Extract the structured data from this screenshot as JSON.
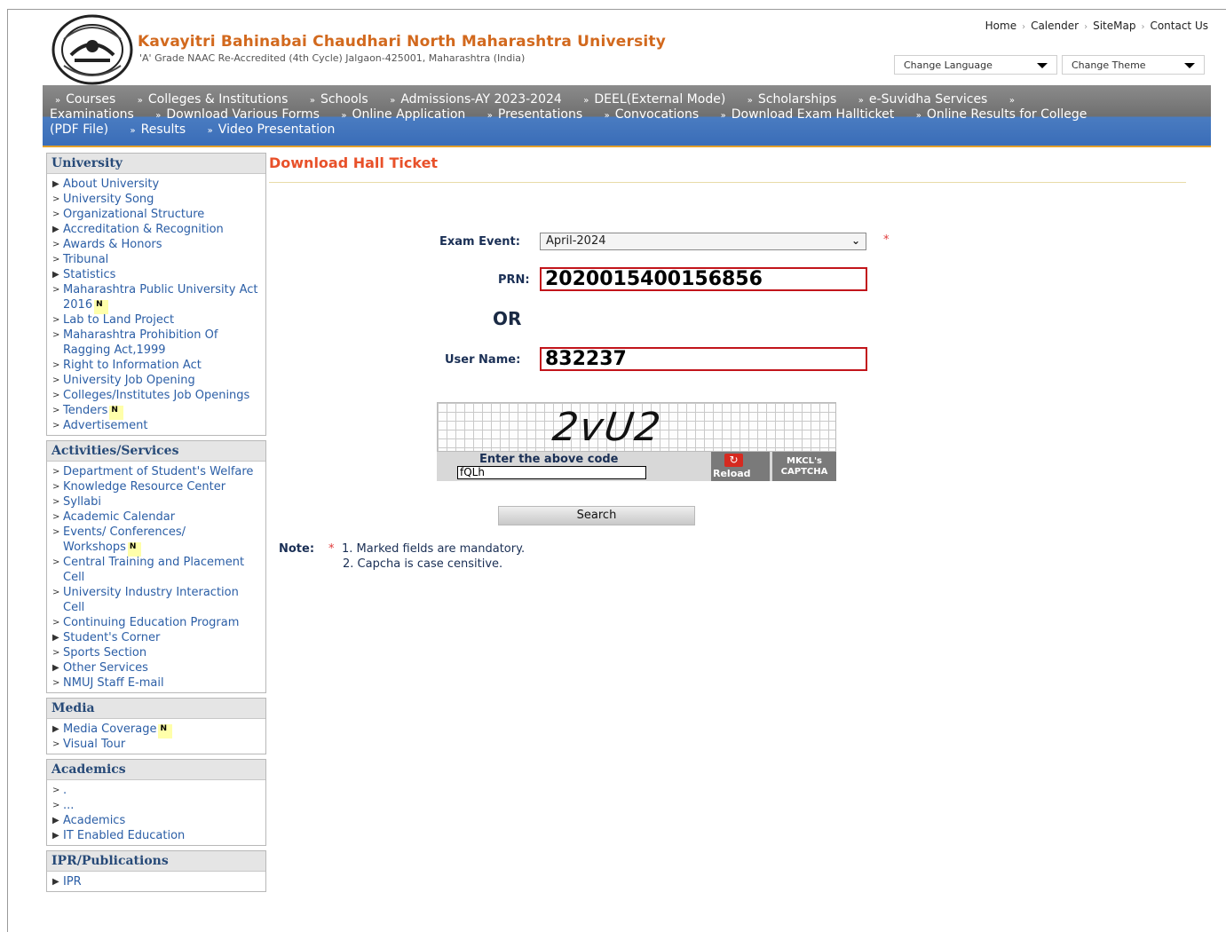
{
  "header": {
    "university_name": "Kavayitri Bahinabai Chaudhari North Maharashtra University",
    "subtitle": "'A' Grade NAAC Re-Accredited (4th Cycle) Jalgaon-425001, Maharashtra (India)",
    "top_links": [
      "Home",
      "Calender",
      "SiteMap",
      "Contact Us"
    ],
    "change_language": "Change Language",
    "change_theme": "Change Theme"
  },
  "menu": {
    "row1": [
      "Courses",
      "Colleges & Institutions",
      "Schools",
      "Admissions-AY 2023-2024",
      "DEEL(External Mode)",
      "Scholarships",
      "e-Suvidha Services",
      ""
    ],
    "row2": [
      "Examinations",
      "Download Various Forms",
      "Online Application",
      "Presentations",
      "Convocations",
      "Download Exam Hallticket",
      "Online Results for College"
    ],
    "row3": [
      "(PDF File)",
      "Results",
      "Video Presentation"
    ]
  },
  "sidebar": {
    "sections": [
      {
        "title": "University",
        "items": [
          {
            "label": "About University",
            "marker": "▶"
          },
          {
            "label": "University Song",
            "marker": ">"
          },
          {
            "label": "Organizational Structure",
            "marker": ">"
          },
          {
            "label": "Accreditation & Recognition",
            "marker": "▶"
          },
          {
            "label": "Awards & Honors",
            "marker": ">"
          },
          {
            "label": "Tribunal",
            "marker": ">"
          },
          {
            "label": "Statistics",
            "marker": "▶"
          },
          {
            "label": "Maharashtra Public University Act 2016",
            "marker": ">",
            "badge": "N"
          },
          {
            "label": "Lab to Land Project",
            "marker": ">"
          },
          {
            "label": "Maharashtra Prohibition Of Ragging Act,1999",
            "marker": ">"
          },
          {
            "label": "Right to Information Act",
            "marker": ">"
          },
          {
            "label": "University Job Opening",
            "marker": ">"
          },
          {
            "label": "Colleges/Institutes Job Openings",
            "marker": ">"
          },
          {
            "label": "Tenders",
            "marker": ">",
            "badge": "N"
          },
          {
            "label": "Advertisement",
            "marker": ">"
          }
        ]
      },
      {
        "title": "Activities/Services",
        "items": [
          {
            "label": "Department of Student's Welfare",
            "marker": ">"
          },
          {
            "label": "Knowledge Resource Center",
            "marker": ">"
          },
          {
            "label": "Syllabi",
            "marker": ">"
          },
          {
            "label": "Academic Calendar",
            "marker": ">"
          },
          {
            "label": "Events/ Conferences/ Workshops",
            "marker": ">",
            "badge": "N"
          },
          {
            "label": "Central Training and Placement Cell",
            "marker": ">"
          },
          {
            "label": "University Industry Interaction Cell",
            "marker": ">"
          },
          {
            "label": "Continuing Education Program",
            "marker": ">"
          },
          {
            "label": "Student's Corner",
            "marker": "▶"
          },
          {
            "label": "Sports Section",
            "marker": ">"
          },
          {
            "label": "Other Services",
            "marker": "▶"
          },
          {
            "label": "NMUJ Staff E-mail",
            "marker": ">"
          }
        ]
      },
      {
        "title": "Media",
        "items": [
          {
            "label": "Media Coverage",
            "marker": "▶",
            "badge": "N"
          },
          {
            "label": "Visual Tour",
            "marker": ">"
          }
        ]
      },
      {
        "title": "Academics",
        "items": [
          {
            "label": ".",
            "marker": ">"
          },
          {
            "label": "...",
            "marker": ">"
          },
          {
            "label": "Academics",
            "marker": "▶"
          },
          {
            "label": "IT Enabled Education",
            "marker": "▶"
          }
        ]
      },
      {
        "title": "IPR/Publications",
        "items": [
          {
            "label": "IPR",
            "marker": "▶"
          }
        ]
      }
    ]
  },
  "main": {
    "page_title": "Download Hall Ticket",
    "exam_event_label": "Exam Event:",
    "exam_event_value": "April-2024",
    "required_star": "*",
    "prn_label": "PRN:",
    "prn_value": "2020015400156856",
    "or_text": "OR",
    "username_label": "User Name:",
    "username_value": "832237",
    "captcha": {
      "code": "2vU2",
      "prompt": "Enter the above code",
      "input_value": "fQLh",
      "reload_label": "Reload",
      "brand": "MKCL's CAPTCHA"
    },
    "search_button": "Search",
    "note_label": "Note:",
    "note_lines": [
      "1. Marked fields are mandatory.",
      "2. Capcha is case censitive."
    ]
  },
  "colors": {
    "title_orange": "#d2691e",
    "page_title_red": "#e8512a",
    "link_blue": "#2b5ea6",
    "input_border_red": "#c2151b",
    "menu_gray": "#7a7a7a",
    "menu_blue": "#3a6db8",
    "badge_yellow": "#ffffaa"
  }
}
